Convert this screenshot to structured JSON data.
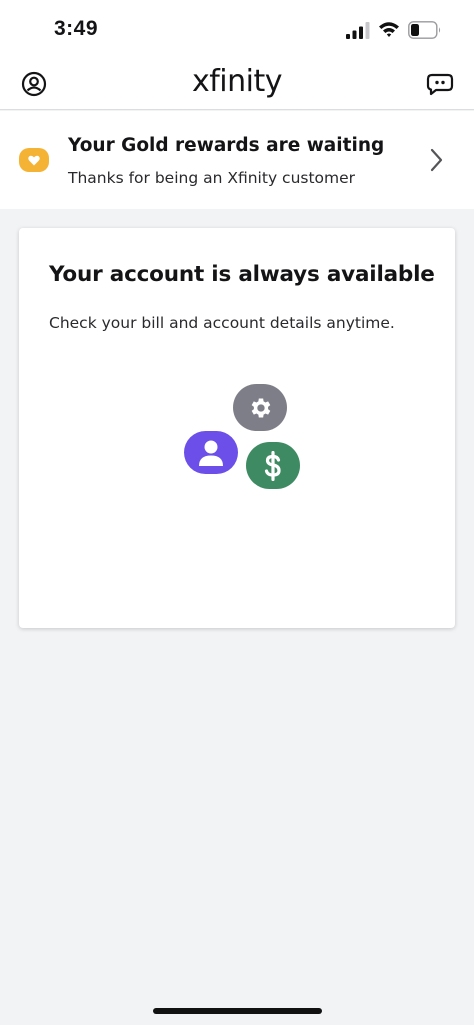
{
  "status_bar": {
    "time": "3:49"
  },
  "header": {
    "logo": "xfinity",
    "left_icon": "account-circle-icon",
    "right_icon": "chat-bubble-icon"
  },
  "rewards_banner": {
    "title": "Your Gold rewards are waiting",
    "subtitle": "Thanks for being an Xfinity customer",
    "badge_icon": "heart-icon",
    "badge_color": "#f5b335"
  },
  "account_card": {
    "title": "Your account is always available",
    "description": "Check your bill and account details anytime.",
    "illustration": {
      "icons": [
        "gear-icon",
        "user-icon",
        "dollar-icon"
      ],
      "colors": {
        "gear": "#7e7e88",
        "user": "#6b4fe8",
        "dollar": "#3e8a62"
      }
    }
  }
}
